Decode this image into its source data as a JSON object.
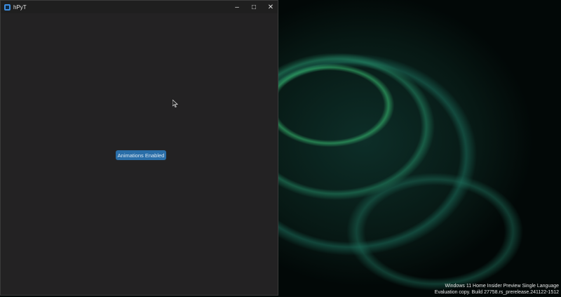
{
  "window": {
    "title": "hPyT",
    "controls": {
      "minimize": "–",
      "maximize": "□",
      "close": "✕"
    }
  },
  "main": {
    "button_label": "Animations Enabled",
    "button_color": "#2a6ea8"
  },
  "desktop": {
    "watermark_line1": "Windows 11 Home Insider Preview Single Language",
    "watermark_line2": "Evaluation copy. Build 27758.rs_prerelease.241122-1512"
  }
}
